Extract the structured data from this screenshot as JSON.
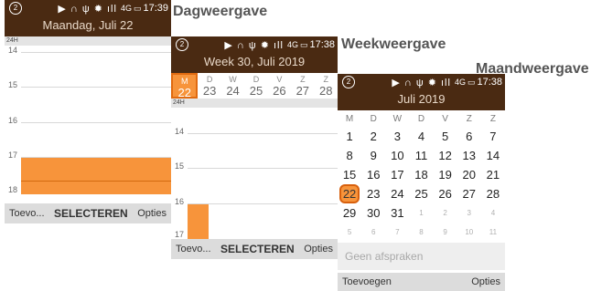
{
  "headings": {
    "day": "Dagweergave",
    "week": "Weekweergave",
    "month": "Maandweergave"
  },
  "status": {
    "time": "17:39",
    "network": "4G",
    "sim": "2"
  },
  "status_week": {
    "time": "17:38",
    "network": "4G",
    "sim": "2"
  },
  "status_month": {
    "time": "17:38",
    "network": "4G",
    "sim": "2"
  },
  "day_view": {
    "title": "Maandag, Juli 22",
    "allday_label": "24H",
    "hours": [
      "14",
      "15",
      "16",
      "17",
      "18"
    ],
    "softkeys": {
      "left": "Toevo...",
      "center": "SELECTEREN",
      "right": "Opties"
    }
  },
  "week_view": {
    "title": "Week 30, Juli 2019",
    "allday_label": "24H",
    "days": [
      {
        "letter": "M",
        "num": "22",
        "selected": true
      },
      {
        "letter": "D",
        "num": "23"
      },
      {
        "letter": "W",
        "num": "24"
      },
      {
        "letter": "D",
        "num": "25"
      },
      {
        "letter": "V",
        "num": "26"
      },
      {
        "letter": "Z",
        "num": "27"
      },
      {
        "letter": "Z",
        "num": "28"
      }
    ],
    "hours": [
      "14",
      "15",
      "16",
      "17"
    ],
    "softkeys": {
      "left": "Toevo...",
      "center": "SELECTEREN",
      "right": "Opties"
    }
  },
  "month_view": {
    "title": "Juli 2019",
    "weekdays": [
      "M",
      "D",
      "W",
      "D",
      "V",
      "Z",
      "Z"
    ],
    "weeks": [
      [
        "1",
        "2",
        "3",
        "4",
        "5",
        "6",
        "7"
      ],
      [
        "8",
        "9",
        "10",
        "11",
        "12",
        "13",
        "14"
      ],
      [
        "15",
        "16",
        "17",
        "18",
        "19",
        "20",
        "21"
      ],
      [
        "22",
        "23",
        "24",
        "25",
        "26",
        "27",
        "28"
      ],
      [
        "29",
        "30",
        "31",
        "1",
        "2",
        "3",
        "4"
      ],
      [
        "5",
        "6",
        "7",
        "8",
        "9",
        "10",
        "11"
      ]
    ],
    "selected_day": "22",
    "no_events": "Geen afspraken",
    "softkeys": {
      "left": "Toevoegen",
      "right": "Opties"
    }
  },
  "colors": {
    "header": "#4a2a12",
    "accent": "#f7943b"
  }
}
